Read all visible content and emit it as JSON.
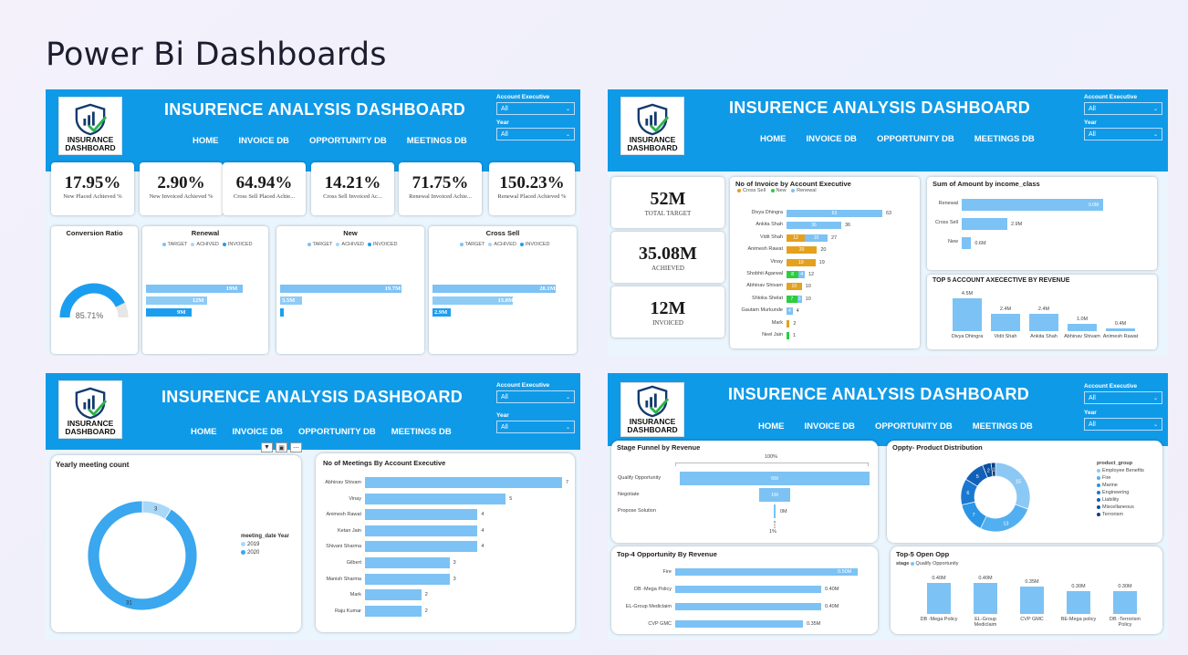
{
  "page_title": "Power Bi Dashboards",
  "dashboard_title": "INSURENCE ANALYSIS DASHBOARD",
  "logo": {
    "line1": "INSURANCE",
    "line2": "DASHBOARD"
  },
  "nav": [
    "HOME",
    "INVOICE DB",
    "OPPORTUNITY DB",
    "MEETINGS DB"
  ],
  "slicers": {
    "account_label": "Account Executive",
    "year_label": "Year",
    "value": "All"
  },
  "colors": {
    "header": "#0f9ae8",
    "bar": "#7cc2f4",
    "bar_dark": "#1c9ef0",
    "orange": "#e3a11e",
    "green": "#2ecc40"
  },
  "p1": {
    "kpis": [
      {
        "value": "17.95%",
        "label": "New Placed Achieved %"
      },
      {
        "value": "2.90%",
        "label": "New Invoiced Achieved %"
      },
      {
        "value": "64.94%",
        "label": "Cross Sell Placed Achie..."
      },
      {
        "value": "14.21%",
        "label": "Cross Sell Invoiced Ac..."
      },
      {
        "value": "71.75%",
        "label": "Renewal Invoiced Achie..."
      },
      {
        "value": "150.23%",
        "label": "Renewal Placed Achieved %"
      }
    ],
    "conversion": {
      "title": "Conversion Ratio",
      "value": "85.71%",
      "ratio": 0.8571
    },
    "legend": [
      "TARGET",
      "ACHIVED",
      "INVOICED"
    ],
    "bullets": [
      {
        "title": "Renewal",
        "bars": [
          {
            "label": "19M",
            "value": 19
          },
          {
            "label": "12M",
            "value": 12
          },
          {
            "label": "9M",
            "value": 9
          }
        ]
      },
      {
        "title": "New",
        "bars": [
          {
            "label": "19.7M",
            "value": 19.7
          },
          {
            "label": "3.5M",
            "value": 3.5
          },
          {
            "label": "",
            "value": 0.6
          }
        ]
      },
      {
        "title": "Cross Sell",
        "bars": [
          {
            "label": "20.1M",
            "value": 20.1
          },
          {
            "label": "13.0M",
            "value": 13.0
          },
          {
            "label": "2.9M",
            "value": 2.9
          }
        ]
      }
    ]
  },
  "p2": {
    "kpis": [
      {
        "value": "52M",
        "label": "TOTAL TARGET"
      },
      {
        "value": "35.08M",
        "label": "ACHIEVED"
      },
      {
        "value": "12M",
        "label": "INVOICED"
      }
    ],
    "invoice_title": "No of Invoice by Account Executive",
    "invoice_legend": [
      "Cross Sell",
      "New",
      "Renewal"
    ],
    "invoice_rows": [
      {
        "name": "Divya Dhingra",
        "cross": 0,
        "new": 0,
        "renewal": 63,
        "total": "63",
        "seg_labels": [
          "",
          "",
          "63"
        ]
      },
      {
        "name": "Ankita Shah",
        "cross": 0,
        "new": 0,
        "renewal": 36,
        "total": "36",
        "seg_labels": [
          "",
          "",
          "36"
        ]
      },
      {
        "name": "Vidit Shah",
        "cross": 12,
        "new": 0,
        "renewal": 15,
        "total": "27",
        "seg_labels": [
          "12",
          "",
          "15"
        ]
      },
      {
        "name": "Animesh Rawat",
        "cross": 20,
        "new": 0,
        "renewal": 0,
        "total": "20",
        "seg_labels": [
          "20",
          "",
          ""
        ]
      },
      {
        "name": "Vinay",
        "cross": 19,
        "new": 0,
        "renewal": 0,
        "total": "19",
        "seg_labels": [
          "19",
          "",
          ""
        ]
      },
      {
        "name": "Shobhit Agarwal",
        "cross": 0,
        "new": 8,
        "renewal": 4,
        "total": "12",
        "seg_labels": [
          "",
          "8",
          "4"
        ]
      },
      {
        "name": "Abhinav Shivam",
        "cross": 10,
        "new": 0,
        "renewal": 0,
        "total": "10",
        "seg_labels": [
          "10",
          "",
          ""
        ]
      },
      {
        "name": "Shloka Shelat",
        "cross": 0,
        "new": 7,
        "renewal": 3,
        "total": "10",
        "seg_labels": [
          "",
          "7",
          "3"
        ]
      },
      {
        "name": "Gautam Murkunde",
        "cross": 0,
        "new": 0,
        "renewal": 4,
        "total": "4",
        "seg_labels": [
          "",
          "",
          "4"
        ]
      },
      {
        "name": "Mark",
        "cross": 2,
        "new": 0,
        "renewal": 0,
        "total": "2",
        "seg_labels": [
          "",
          "",
          ""
        ]
      },
      {
        "name": "Neel Jain",
        "cross": 0,
        "new": 1,
        "renewal": 0,
        "total": "1",
        "seg_labels": [
          "",
          "",
          ""
        ]
      }
    ],
    "income_title": "Sum of Amount by income_class",
    "income_rows": [
      {
        "name": "Renewal",
        "value": 9.0,
        "label": "9.0M"
      },
      {
        "name": "Cross Sell",
        "value": 2.9,
        "label": "2.9M"
      },
      {
        "name": "New",
        "value": 0.6,
        "label": "0.6M"
      }
    ],
    "top5_title": "TOP 5 ACCOUNT AXECECTIVE BY REVENUE",
    "top5": [
      {
        "name": "Divya Dhingra",
        "value": 4.5,
        "label": "4.5M"
      },
      {
        "name": "Vidit Shah",
        "value": 2.4,
        "label": "2.4M"
      },
      {
        "name": "Ankita Shah",
        "value": 2.4,
        "label": "2.4M"
      },
      {
        "name": "Abhinav Shivam",
        "value": 1.0,
        "label": "1.0M"
      },
      {
        "name": "Animesh Rawat",
        "value": 0.4,
        "label": "0.4M"
      }
    ]
  },
  "p3": {
    "yearly_title": "Yearly meeting count",
    "yearly_legend_title": "meeting_date Year",
    "yearly": [
      {
        "year": "2019",
        "count": 3,
        "label": "3"
      },
      {
        "year": "2020",
        "count": 31,
        "label": "31"
      }
    ],
    "meetings_title": "No of Meetings By Account Executive",
    "meetings": [
      {
        "name": "Abhinav Shivam",
        "value": 7
      },
      {
        "name": "Vinay",
        "value": 5
      },
      {
        "name": "Animesh Rawat",
        "value": 4
      },
      {
        "name": "Ketan Jain",
        "value": 4
      },
      {
        "name": "Shivani Sharma",
        "value": 4
      },
      {
        "name": "Gilbert",
        "value": 3
      },
      {
        "name": "Manish Sharma",
        "value": 3
      },
      {
        "name": "Mark",
        "value": 2
      },
      {
        "name": "Raju Kumar",
        "value": 2
      }
    ],
    "toolbar": [
      "filter-icon",
      "focus-icon",
      "more-icon"
    ]
  },
  "p4": {
    "funnel_title": "Stage Funnel by Revenue",
    "funnel_top": "100%",
    "funnel_bottom": "1%",
    "funnel": [
      {
        "name": "Qualify Opportunity",
        "value": 6,
        "label": "6M"
      },
      {
        "name": "Negotiate",
        "value": 1,
        "label": "1M"
      },
      {
        "name": "Propose Solution",
        "value": 0.05,
        "label": "0M"
      }
    ],
    "donut_title": "Oppty- Product Distribution",
    "donut_legend_title": "product_group",
    "donut": [
      {
        "name": "Employee Benefits",
        "value": 15,
        "label": "15",
        "color": "#8cc8f4"
      },
      {
        "name": "Fire",
        "value": 13,
        "label": "13",
        "color": "#52b0f0"
      },
      {
        "name": "Marine",
        "value": 7,
        "label": "7",
        "color": "#2b95e6"
      },
      {
        "name": "Engineering",
        "value": 6,
        "label": "6",
        "color": "#1a78d0"
      },
      {
        "name": "Liability",
        "value": 5,
        "label": "5",
        "color": "#1161b8"
      },
      {
        "name": "Miscellaneous",
        "value": 2,
        "label": "2",
        "color": "#0c4f9c"
      },
      {
        "name": "Terrorism",
        "value": 1,
        "label": "1",
        "color": "#0a3f80"
      }
    ],
    "top4_title": "Top-4 Opportunity By Revenue",
    "top4": [
      {
        "name": "Fire",
        "value": 0.5,
        "label": "0.50M"
      },
      {
        "name": "DB -Mega Policy",
        "value": 0.4,
        "label": "0.40M"
      },
      {
        "name": "EL-Group Mediclaim",
        "value": 0.4,
        "label": "0.40M"
      },
      {
        "name": "CVP GMC",
        "value": 0.35,
        "label": "0.35M"
      }
    ],
    "top5_title": "Top-5 Open Opp",
    "top5_legend_key": "stage",
    "top5_legend": "Qualify Opportunity",
    "top5": [
      {
        "name": "DB -Mega Policy",
        "value": 0.4,
        "label": "0.40M"
      },
      {
        "name": "EL-Group Mediclaim",
        "value": 0.4,
        "label": "0.40M"
      },
      {
        "name": "CVP GMC",
        "value": 0.35,
        "label": "0.35M"
      },
      {
        "name": "BE-Mega policy",
        "value": 0.3,
        "label": "0.30M"
      },
      {
        "name": "DB -Terrorism Policy",
        "value": 0.3,
        "label": "0.30M"
      }
    ]
  }
}
